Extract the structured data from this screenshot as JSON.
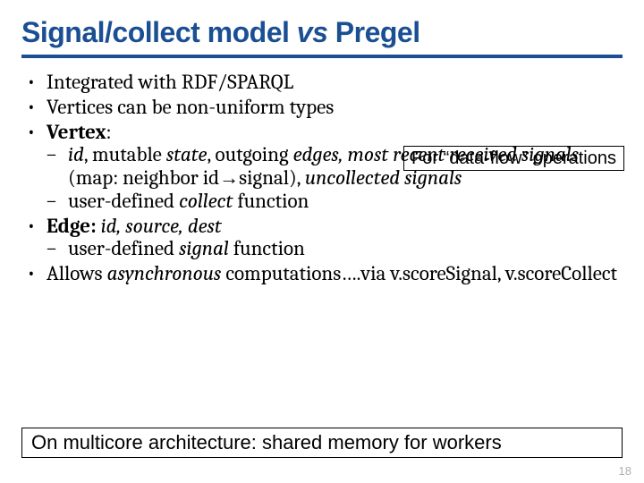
{
  "title": {
    "part1": "Signal/collect model ",
    "vs": "vs",
    "part2": " Pregel"
  },
  "callout": "For “data-flow” operations",
  "bullets": {
    "b1": "Integrated with RDF/SPARQL",
    "b2": "Vertices can be non-uniform types",
    "b3_label": "Vertex",
    "b3_colon": ":",
    "b3_sub1": {
      "id": "id",
      "mutable_state_pre": ", mutable ",
      "state": "state",
      "outgoing_pre": ", outgoing ",
      "edges_recent": "edges, most recent received signals",
      "map_pre": " (map: neighbor id",
      "map_post": "signal), ",
      "uncollected": "uncollected signals"
    },
    "b3_sub2_pre": "user-defined ",
    "b3_sub2_collect": "collect",
    "b3_sub2_post": " function",
    "b4_label": "Edge:",
    "b4_italic": " id, source, dest",
    "b4_sub_pre": "user-defined ",
    "b4_sub_signal": "signal",
    "b4_sub_post": " function",
    "b5_pre": "Allows ",
    "b5_async": "asynchronous",
    "b5_post": " computations….via v.scoreSignal, v.scoreCollect"
  },
  "footer": "On multicore architecture: shared memory for workers",
  "page_number": "18"
}
